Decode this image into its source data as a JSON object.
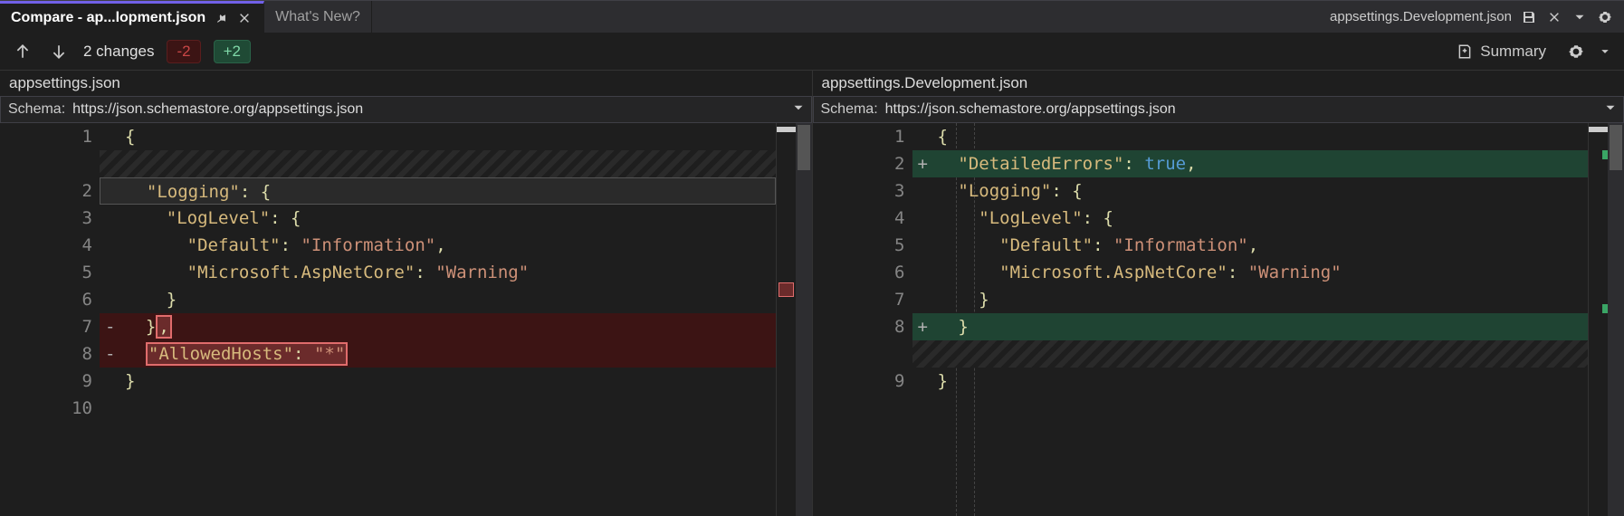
{
  "tabs": {
    "active": {
      "title": "Compare - ap...lopment.json"
    },
    "inactive": {
      "title": "What's New?"
    },
    "right": {
      "filename": "appsettings.Development.json"
    }
  },
  "toolbar": {
    "changes_label": "2 changes",
    "minus_badge": "-2",
    "plus_badge": "+2",
    "summary_label": "Summary"
  },
  "left_pane": {
    "header": "appsettings.json",
    "schema_label": "Schema:",
    "schema_url": "https://json.schemastore.org/appsettings.json",
    "lines": {
      "n1": "1",
      "n2": "2",
      "n3": "3",
      "n4": "4",
      "n5": "5",
      "n6": "6",
      "n7": "7",
      "n8": "8",
      "n9": "9",
      "n10": "10"
    },
    "code": {
      "l1_open": "{",
      "l2_key": "\"Logging\"",
      "l2_colon": ": ",
      "l2_brace": "{",
      "l3_key": "\"LogLevel\"",
      "l3_colon": ": ",
      "l3_brace": "{",
      "l4_key": "\"Default\"",
      "l4_colon": ": ",
      "l4_val": "\"Information\"",
      "l4_comma": ",",
      "l5_key": "\"Microsoft.AspNetCore\"",
      "l5_colon": ": ",
      "l5_val": "\"Warning\"",
      "l6_close": "}",
      "l7_close": "}",
      "l7_comma": ",",
      "l8_key": "\"AllowedHosts\"",
      "l8_colon": ": ",
      "l8_val": "\"*\"",
      "l9_close": "}"
    }
  },
  "right_pane": {
    "header": "appsettings.Development.json",
    "schema_label": "Schema:",
    "schema_url": "https://json.schemastore.org/appsettings.json",
    "lines": {
      "n1": "1",
      "n2": "2",
      "n3": "3",
      "n4": "4",
      "n5": "5",
      "n6": "6",
      "n7": "7",
      "n8": "8",
      "n9": "9"
    },
    "code": {
      "l1_open": "{",
      "l2_key": "\"DetailedErrors\"",
      "l2_colon": ": ",
      "l2_val": "true",
      "l2_comma": ",",
      "l3_key": "\"Logging\"",
      "l3_colon": ": ",
      "l3_brace": "{",
      "l4_key": "\"LogLevel\"",
      "l4_colon": ": ",
      "l4_brace": "{",
      "l5_key": "\"Default\"",
      "l5_colon": ": ",
      "l5_val": "\"Information\"",
      "l5_comma": ",",
      "l6_key": "\"Microsoft.AspNetCore\"",
      "l6_colon": ": ",
      "l6_val": "\"Warning\"",
      "l7_close": "}",
      "l8_close": "}",
      "l9_close": "}"
    }
  }
}
